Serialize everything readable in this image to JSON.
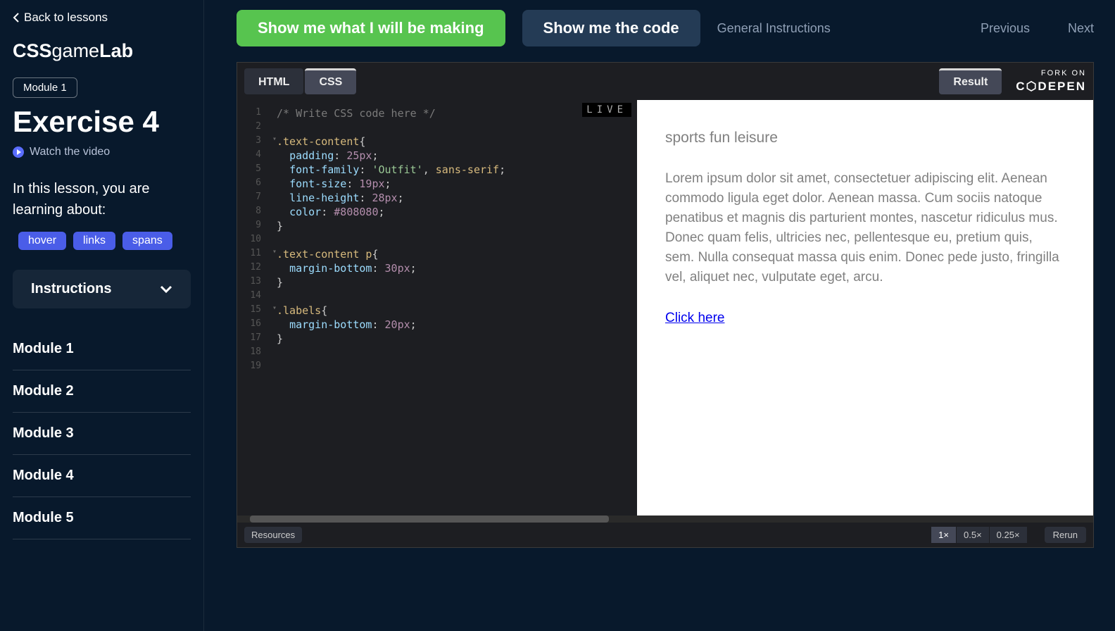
{
  "sidebar": {
    "back": "Back to lessons",
    "logo_css": "CSS",
    "logo_game": "game",
    "logo_lab": "Lab",
    "module_badge": "Module 1",
    "title": "Exercise 4",
    "watch": "Watch the video",
    "intro": "In this lesson, you are learning about:",
    "tags": [
      "hover",
      "links",
      "spans"
    ],
    "instructions": "Instructions",
    "modules": [
      "Module 1",
      "Module 2",
      "Module 3",
      "Module 4",
      "Module 5"
    ]
  },
  "header": {
    "show_making": "Show me what I will be making",
    "show_code": "Show me the code",
    "general": "General Instructions",
    "prev": "Previous",
    "next": "Next"
  },
  "embed": {
    "tabs": {
      "html": "HTML",
      "css": "CSS",
      "result": "Result"
    },
    "fork_top": "FORK ON",
    "fork_bottom": "C⬡DEPEN",
    "live": "LIVE",
    "resources": "Resources",
    "zoom": [
      "1×",
      "0.5×",
      "0.25×"
    ],
    "rerun": "Rerun"
  },
  "code": {
    "l1": "/* Write CSS code here */",
    "l3_sel": ".text-content",
    "l4_prop": "padding",
    "l4_val": "25px",
    "l5_prop": "font-family",
    "l5_val1": "'Outfit'",
    "l5_val2": "sans-serif",
    "l6_prop": "font-size",
    "l6_val": "19px",
    "l7_prop": "line-height",
    "l7_val": "28px",
    "l8_prop": "color",
    "l8_val": "#808080",
    "l11_sel": ".text-content p",
    "l12_prop": "margin-bottom",
    "l12_val": "30px",
    "l15_sel": ".labels",
    "l16_prop": "margin-bottom",
    "l16_val": "20px"
  },
  "result": {
    "labels": "sports fun leisure",
    "para": "Lorem ipsum dolor sit amet, consectetuer adipiscing elit. Aenean commodo ligula eget dolor. Aenean massa. Cum sociis natoque penatibus et magnis dis parturient montes, nascetur ridiculus mus. Donec quam felis, ultricies nec, pellentesque eu, pretium quis, sem. Nulla consequat massa quis enim. Donec pede justo, fringilla vel, aliquet nec, vulputate eget, arcu.",
    "link": "Click here"
  }
}
